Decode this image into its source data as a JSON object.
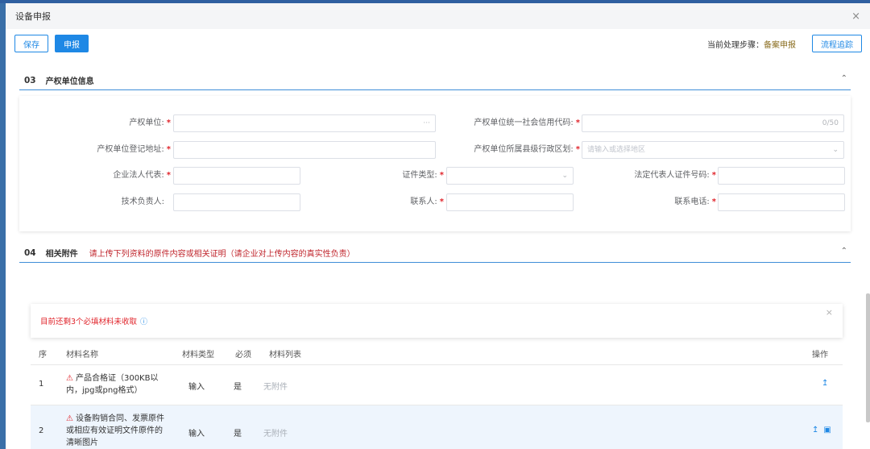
{
  "dialog": {
    "title": "设备申报",
    "close": "×"
  },
  "toolbar": {
    "save_label": "保存",
    "submit_label": "申报",
    "step_label": "当前处理步骤：",
    "step_value": "备案申报",
    "track_label": "流程追踪"
  },
  "section03": {
    "num": "03",
    "title": "产权单位信息",
    "chevron": "^"
  },
  "form": {
    "owner_unit": {
      "label": "产权单位:",
      "suffix": "···"
    },
    "credit_code": {
      "label": "产权单位统一社会信用代码:",
      "counter": "0/50"
    },
    "reg_address": {
      "label": "产权单位登记地址:"
    },
    "region": {
      "label": "产权单位所属县级行政区划:",
      "placeholder": "请输入或选择地区"
    },
    "legal_rep": {
      "label": "企业法人代表:"
    },
    "id_type": {
      "label": "证件类型:"
    },
    "legal_id": {
      "label": "法定代表人证件号码:"
    },
    "tech_lead": {
      "label": "技术负责人:"
    },
    "contact": {
      "label": "联系人:"
    },
    "phone": {
      "label": "联系电话:"
    }
  },
  "section04": {
    "num": "04",
    "title": "相关附件",
    "note": "请上传下列资料的原件内容或相关证明（请企业对上传内容的真实性负责）",
    "chevron": "^"
  },
  "notice": {
    "text": "目前还剩3个必填材料未收取",
    "close": "×"
  },
  "table": {
    "headers": {
      "seq": "序",
      "name": "材料名称",
      "type": "材料类型",
      "required": "必须",
      "list": "材料列表",
      "action": "操作"
    },
    "rows": [
      {
        "seq": "1",
        "name_line1": "产品合格证（300KB以",
        "name_line2": "内，jpg或png格式）",
        "name_line3": "",
        "type": "输入",
        "required": "是",
        "list": "无附件"
      },
      {
        "seq": "2",
        "name_line1": "设备购销合同、发票原件",
        "name_line2": "或相应有效证明文件原件的",
        "name_line3": "清晰图片",
        "type": "输入",
        "required": "是",
        "list": "无附件"
      }
    ]
  },
  "colors": {
    "accent": "#1e88e5",
    "required_star": "#e0242b",
    "warning_text": "#c0262d",
    "step_value": "#8a6d1f"
  },
  "icons": [
    "close-icon",
    "chevron-up-icon",
    "chevron-down-icon",
    "info-icon",
    "warning-icon",
    "upload-icon",
    "preview-icon"
  ]
}
